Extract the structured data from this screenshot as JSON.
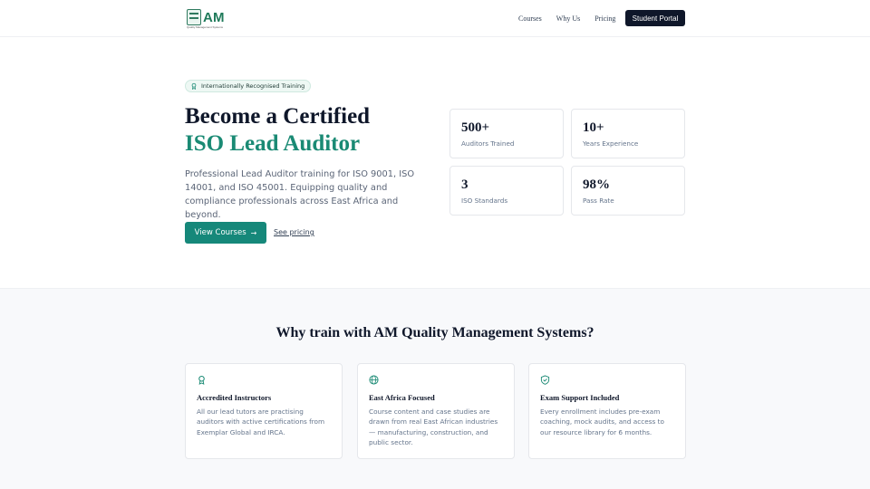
{
  "header": {
    "logo_text": "AM",
    "logo_subtitle": "Quality Management Systems",
    "nav": [
      "Courses",
      "Why Us",
      "Pricing"
    ],
    "portal_label": "Student Portal"
  },
  "hero": {
    "badge": "Internationally Recognised Training",
    "title_line1": "Become a Certified",
    "title_line2": "ISO Lead Auditor",
    "description": "Professional Lead Auditor training for ISO 9001, ISO 14001, and ISO 45001. Equipping quality and compliance professionals across East Africa and beyond.",
    "primary_cta": "View Courses",
    "secondary_cta": "See pricing"
  },
  "stats": [
    {
      "value": "500+",
      "label": "Auditors Trained"
    },
    {
      "value": "10+",
      "label": "Years Experience"
    },
    {
      "value": "3",
      "label": "ISO Standards"
    },
    {
      "value": "98%",
      "label": "Pass Rate"
    }
  ],
  "why": {
    "title": "Why train with AM Quality Management Systems?",
    "cards": [
      {
        "icon": "award-icon",
        "title": "Accredited Instructors",
        "desc": "All our lead tutors are practising auditors with active certifications from Exemplar Global and IRCA."
      },
      {
        "icon": "globe-icon",
        "title": "East Africa Focused",
        "desc": "Course content and case studies are drawn from real East African industries — manufacturing, construction, and public sector."
      },
      {
        "icon": "shield-check-icon",
        "title": "Exam Support Included",
        "desc": "Every enrollment includes pre-exam coaching, mock audits, and access to our resource library for 6 months."
      }
    ]
  },
  "colors": {
    "accent": "#16887a",
    "dark": "#0f172a"
  }
}
